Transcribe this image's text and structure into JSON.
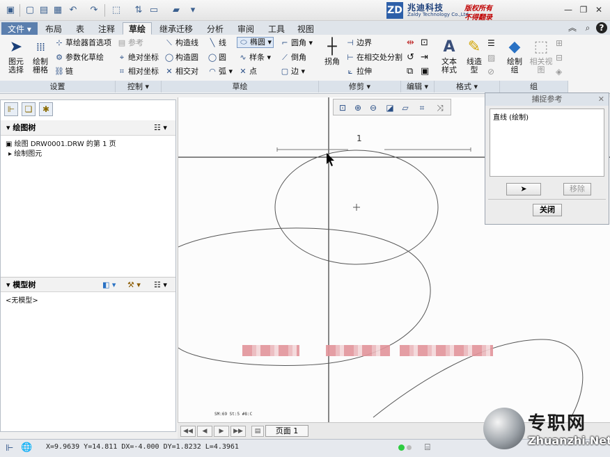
{
  "qat": {
    "icons": [
      "app-icon",
      "new-icon",
      "open-icon",
      "save-icon",
      "undo-icon",
      "redo-icon",
      "select-box-icon",
      "regenerate-icon",
      "window-icon",
      "folder-icon",
      "more-icon"
    ]
  },
  "brand": {
    "logo": "ZD",
    "name_cn": "兆迪科技",
    "name_en": "Zaldy Technology Co.,Ltd.",
    "copyright_1": "版权所有",
    "copyright_2": "不得翻录"
  },
  "tabs": [
    {
      "label": "文件"
    },
    {
      "label": "布局"
    },
    {
      "label": "表"
    },
    {
      "label": "注释"
    },
    {
      "label": "草绘"
    },
    {
      "label": "继承迁移"
    },
    {
      "label": "分析"
    },
    {
      "label": "审阅"
    },
    {
      "label": "工具"
    },
    {
      "label": "视图"
    }
  ],
  "ribbon": {
    "settings": {
      "label": "设置",
      "select": "图元\n选择",
      "grid": "绘制\n栅格",
      "sketcher_prefs": "草绘器首选项",
      "param_sketch": "参数化草绘",
      "chain": "链"
    },
    "control": {
      "label": "控制",
      "reference": "参考",
      "abs_coord": "绝对坐标",
      "rel_coord": "相对坐标"
    },
    "sketch": {
      "label": "草绘",
      "construction_line": "构造线",
      "construction_circle": "构造圆",
      "intersect": "相交对",
      "line": "线",
      "circle": "圆",
      "arc": "弧",
      "ellipse": "椭圆",
      "spline": "样条",
      "point": "点",
      "fillet": "圆角",
      "chamfer": "倒角",
      "edge": "边"
    },
    "trim": {
      "label": "修剪",
      "corner": "拐角",
      "boundary": "边界",
      "split": "在相交处分割",
      "stretch": "拉伸"
    },
    "edit": {
      "label": "编辑"
    },
    "format": {
      "label": "格式",
      "text_style": "文本\n样式",
      "line_style": "线造\n型"
    },
    "group": {
      "label": "组",
      "draw_group": "绘制\n组",
      "related_view": "相关视\n图"
    }
  },
  "left_panel": {
    "drawing_tree": {
      "title": "绘图树",
      "root": "绘图 DRW0001.DRW 的第 1 页",
      "child": "绘制图元"
    },
    "model_tree": {
      "title": "模型树",
      "empty": "<无模型>"
    }
  },
  "dialog": {
    "title": "捕捉参考",
    "list_item": "直线 (绘制)",
    "remove_label": "移除",
    "close_label": "关闭"
  },
  "canvas": {
    "dimension_label": "1",
    "small_text": "SM:69  St:5  #8:C"
  },
  "pager": {
    "page_label": "页面 1"
  },
  "status": {
    "coords": "X=9.9639 Y=14.811 DX=-4.000 DY=1.8232 L=4.3961"
  },
  "watermark": {
    "cn": "专职网",
    "en": "Zhuanzhi.Net"
  }
}
